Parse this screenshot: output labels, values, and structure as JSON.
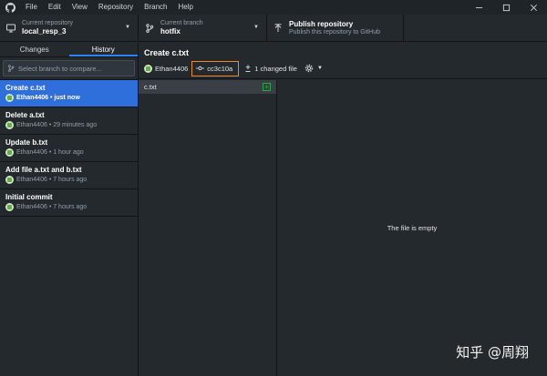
{
  "menu": {
    "items": [
      "File",
      "Edit",
      "View",
      "Repository",
      "Branch",
      "Help"
    ]
  },
  "toolbar": {
    "repo": {
      "label": "Current repository",
      "value": "local_resp_3"
    },
    "branch": {
      "label": "Current branch",
      "value": "hotfix"
    },
    "publish": {
      "label": "Publish repository",
      "value": "Publish this repository to GitHub"
    }
  },
  "sidebar": {
    "tabs": {
      "changes": "Changes",
      "history": "History"
    },
    "compare_placeholder": "Select branch to compare...",
    "commits": [
      {
        "title": "Create c.txt",
        "author": "Ethan4406",
        "time": "just now"
      },
      {
        "title": "Delete a.txt",
        "author": "Ethan4406",
        "time": "29 minutes ago"
      },
      {
        "title": "Update b.txt",
        "author": "Ethan4406",
        "time": "1 hour ago"
      },
      {
        "title": "Add file a.txt and b.txt",
        "author": "Ethan4406",
        "time": "7 hours ago"
      },
      {
        "title": "Initial commit",
        "author": "Ethan4406",
        "time": "7 hours ago"
      }
    ]
  },
  "detail": {
    "title": "Create c.txt",
    "author": "Ethan4406",
    "sha": "cc3c10a",
    "changed_files": "1 changed file",
    "files": [
      {
        "name": "c.txt",
        "status": "added"
      }
    ],
    "empty_message": "The file is empty"
  },
  "watermark": "知乎 @周翔",
  "colors": {
    "accent": "#2f6fdc",
    "highlight_box": "#f08a24",
    "added": "#28a745"
  }
}
